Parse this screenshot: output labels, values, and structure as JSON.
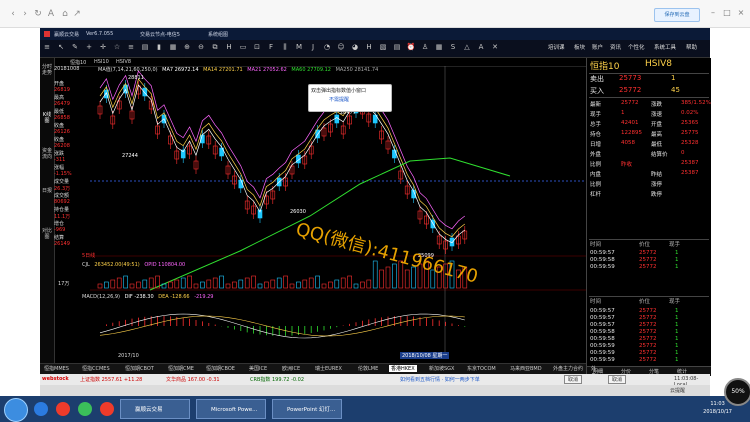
{
  "browser": {
    "save_label": "保存到云盘",
    "nav_icons": [
      "back-icon",
      "forward-icon",
      "refresh-icon",
      "translate-icon",
      "home-icon",
      "share-icon"
    ]
  },
  "app": {
    "title": "赢顺云交易",
    "version": "Ver6.7.055",
    "node": "交易云节点-电信5",
    "sys_info": "系统组图",
    "menu": [
      "培训课",
      "板块",
      "账户",
      "资讯",
      "个性化",
      "系统工具",
      "帮助"
    ],
    "subbar": [
      "恒指10",
      "HSI10",
      "HSIV8"
    ],
    "ma_line": {
      "label": "MA值(7,14,21,60,250,0)",
      "ma7": "MA7 26972.14",
      "ma14": "MA14 27201.71",
      "ma21": "MA21 27052.62",
      "ma60": "MA60 27709.12",
      "ma250": "MA250 28141.74"
    },
    "ohlc": [
      {
        "k": "20181008",
        "v": ""
      },
      {
        "k": "开盘",
        "v": "26819"
      },
      {
        "k": "最高",
        "v": "26479"
      },
      {
        "k": "最低",
        "v": "26858"
      },
      {
        "k": "收盘",
        "v": "26126"
      },
      {
        "k": "收盘",
        "v": "26208"
      },
      {
        "k": "涨跌",
        "v": "-311"
      },
      {
        "k": "涨幅",
        "v": "-1.15%"
      },
      {
        "k": "成交量",
        "v": "26.3万"
      },
      {
        "k": "成交额",
        "v": "80692"
      },
      {
        "k": "持仓量",
        "v": "11.1万"
      },
      {
        "k": "增仓",
        "v": "-969"
      },
      {
        "k": "结算",
        "v": "26149"
      }
    ],
    "left_nav": [
      "分时走势",
      "K线图",
      "资金流向",
      "日报",
      "对比图"
    ],
    "chart_labels": {
      "p1": "28811",
      "p2": "27244",
      "p3": "28477",
      "p4": "26030",
      "p5": "25099",
      "vol_label": "CJL",
      "vol": "263452.00(49:51)",
      "opid": "OPID 110804.00",
      "vol_unit": "17万",
      "macd": "MACD(12,26,9)",
      "dif": "DIF -238.30",
      "dea": "DEA -128.66",
      "macd_val": "-219.29",
      "year": "2017/10",
      "cursor_date": "2018/10/08 星期一",
      "tf": "5日线"
    },
    "tooltip": {
      "text": "双击弹出指标数值小窗口",
      "btn": "不需提醒"
    },
    "watermark": "QQ(微信):411966170"
  },
  "quote": {
    "name": "恒指10",
    "code": "HSIV8",
    "sell": {
      "label": "卖出",
      "price": "25773",
      "qty": "1"
    },
    "buy": {
      "label": "买入",
      "price": "25772",
      "qty": "45"
    },
    "rows": [
      {
        "l1": "最新",
        "v1": "25772",
        "l2": "涨跌",
        "v2": "385/1.52%"
      },
      {
        "l1": "现手",
        "v1": "1",
        "l2": "涨速",
        "v2": "0.02%"
      },
      {
        "l1": "总手",
        "v1": "42401",
        "l2": "开盘",
        "v2": "25365"
      },
      {
        "l1": "持仓",
        "v1": "122895",
        "l2": "最高",
        "v2": "25775"
      },
      {
        "l1": "日增",
        "v1": "4058",
        "l2": "最低",
        "v2": "25328"
      },
      {
        "l1": "外盘",
        "v1": "",
        "l2": "结算价",
        "v2": "0"
      },
      {
        "l1": "比例",
        "v1": "昨收",
        "l2": "",
        "v2": "25387"
      },
      {
        "l1": "内盘",
        "v1": "",
        "l2": "昨结",
        "v2": "25387"
      },
      {
        "l1": "比例",
        "v1": "",
        "l2": "涨停",
        "v2": ""
      },
      {
        "l1": "杠杆",
        "v1": "",
        "l2": "跌停",
        "v2": ""
      }
    ],
    "tick_header": {
      "time": "时间",
      "price": "价位",
      "qty": "现手"
    },
    "ticks1": [
      {
        "t": "00:59:57",
        "p": "25772",
        "q": "1"
      },
      {
        "t": "00:59:58",
        "p": "25772",
        "q": "1"
      },
      {
        "t": "00:59:59",
        "p": "25772",
        "q": "1"
      }
    ],
    "ticks2": [
      {
        "t": "00:59:57",
        "p": "25772",
        "q": "1"
      },
      {
        "t": "00:59:57",
        "p": "25772",
        "q": "1"
      },
      {
        "t": "00:59:57",
        "p": "25772",
        "q": "1"
      },
      {
        "t": "00:59:58",
        "p": "25772",
        "q": "1"
      },
      {
        "t": "00:59:58",
        "p": "25772",
        "q": "1"
      },
      {
        "t": "00:59:59",
        "p": "25772",
        "q": "1"
      },
      {
        "t": "00:59:59",
        "p": "25772",
        "q": "1"
      },
      {
        "t": "00:59:59",
        "p": "25772",
        "q": "1"
      }
    ],
    "tabs": [
      "明细",
      "分价",
      "分笔",
      "统计"
    ]
  },
  "bottom_tabs": [
    "恒指MMES",
    "恒指CCMES",
    "恒加期CBOT",
    "恒加期CME",
    "恒加期CBOE",
    "美国ICE",
    "欧洲ICE",
    "瑞士EUREX",
    "伦敦LME",
    "香港HKEX",
    "新加坡SGX",
    "东京TOCOM",
    "马来西亚BMD",
    "外盘主力合约",
    "外盘加权指数"
  ],
  "status": {
    "brand": "webstock",
    "s1": "上证指数 2557.61 +11.28",
    "s2": "文华商品 167.00 -0.31",
    "s3": "CRB指数 199.72 -0.02",
    "ticker": "如何看到五档行情 · 如何一两步下单",
    "b1": "取消",
    "b2": "取消",
    "time": "11:03:08-Local",
    "badge": "云提醒"
  },
  "taskbar": {
    "apps": [
      "赢顺云交易",
      "Microsoft Powe...",
      "PowerPoint 幻灯..."
    ],
    "clock_time": "11:03",
    "clock_date": "2018/10/17"
  },
  "speed": "50%"
}
